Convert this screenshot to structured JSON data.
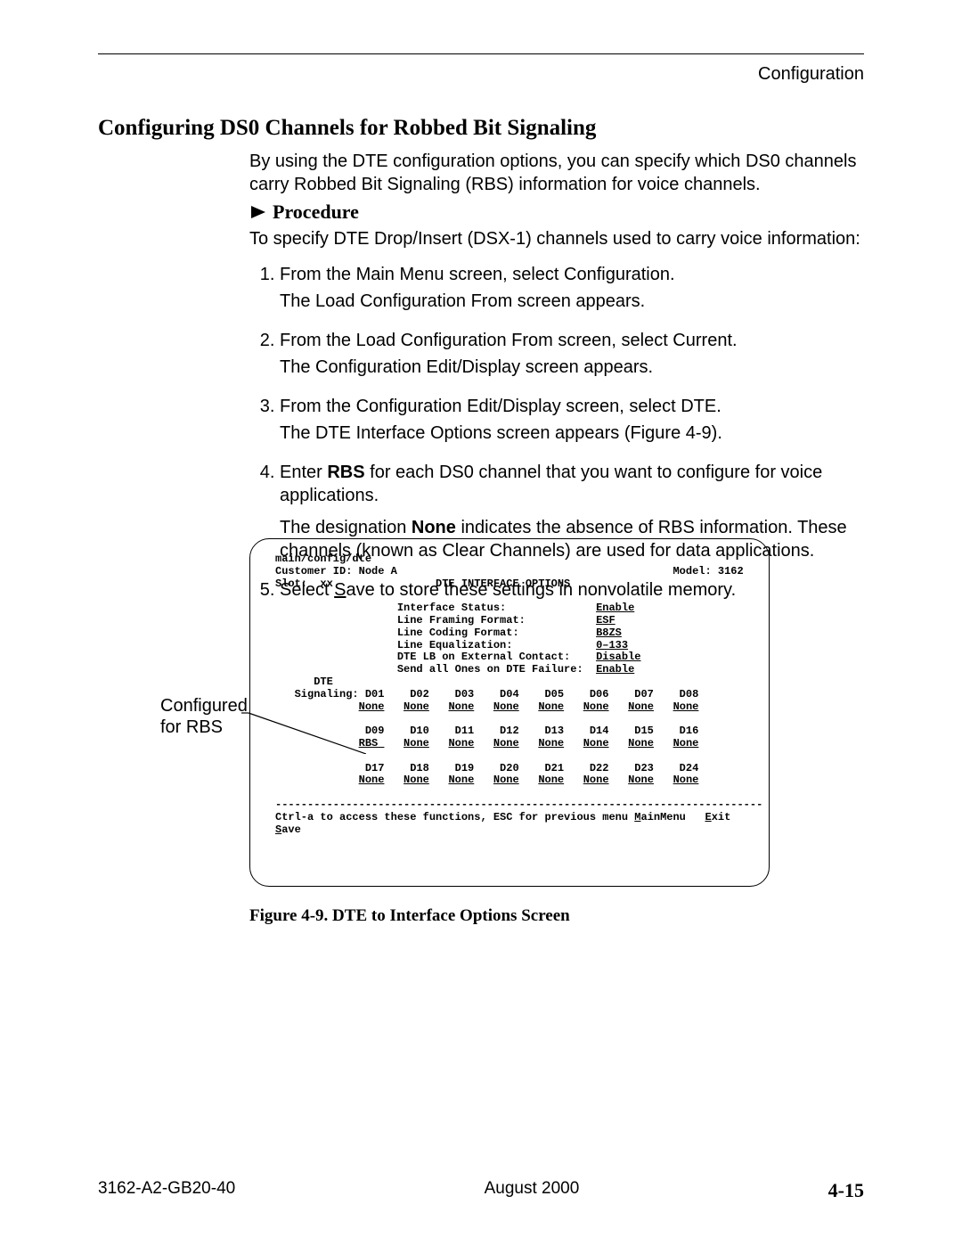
{
  "header": {
    "section": "Configuration"
  },
  "title": "Configuring DS0 Channels for Robbed Bit Signaling",
  "intro": "By using the DTE configuration options, you can specify which DS0 channels carry Robbed Bit Signaling (RBS) information for voice channels.",
  "procedure_label": "Procedure",
  "procedure_intro": "To specify DTE Drop/Insert (DSX-1) channels used to carry voice information:",
  "steps": {
    "s1a": "From the Main Menu screen, select Configuration.",
    "s1b": "The Load Configuration From screen appears.",
    "s2a": "From the Load Configuration From screen, select Current.",
    "s2b": "The Configuration Edit/Display screen appears.",
    "s3a": "From the Configuration Edit/Display screen, select DTE.",
    "s3b": "The DTE Interface Options screen appears (Figure 4-9).",
    "s4a_pre": "Enter ",
    "s4a_bold": "RBS",
    "s4a_post": " for each DS0 channel that you want to configure for voice applications.",
    "s4b_pre": "The designation ",
    "s4b_bold": "None",
    "s4b_post": " indicates the absence of RBS information. These channels (known as Clear Channels) are used for data applications.",
    "s5_pre": "Select ",
    "s5_u": "S",
    "s5_post": "ave to store these settings in nonvolatile memory."
  },
  "callout": {
    "line1": "Configured",
    "line2": "for RBS"
  },
  "terminal": {
    "path": "main/config/dte",
    "customer_label": "Customer ID:",
    "customer_value": "Node A",
    "model_label": "Model:",
    "model_value": "3162",
    "slot_label": "Slot:",
    "slot_value": "xx",
    "screen_title": "DTE INTERFACE OPTIONS",
    "opts": [
      {
        "label": "Interface Status:",
        "value": "Enable"
      },
      {
        "label": "Line Framing Format:",
        "value": "ESF"
      },
      {
        "label": "Line Coding Format:",
        "value": "B8ZS"
      },
      {
        "label": "Line Equalization:",
        "value": "0–133"
      },
      {
        "label": "DTE LB on External Contact:",
        "value": "Disable"
      },
      {
        "label": "Send all Ones on DTE Failure:",
        "value": "Enable"
      }
    ],
    "dte_label": "DTE",
    "signaling_label": "Signaling:",
    "channels": {
      "row1": {
        "labels": [
          "D01",
          "D02",
          "D03",
          "D04",
          "D05",
          "D06",
          "D07",
          "D08"
        ],
        "values": [
          "None",
          "None",
          "None",
          "None",
          "None",
          "None",
          "None",
          "None"
        ]
      },
      "row2": {
        "labels": [
          "D09",
          "D10",
          "D11",
          "D12",
          "D13",
          "D14",
          "D15",
          "D16"
        ],
        "values": [
          "RBS",
          "None",
          "None",
          "None",
          "None",
          "None",
          "None",
          "None"
        ]
      },
      "row3": {
        "labels": [
          "D17",
          "D18",
          "D19",
          "D20",
          "D21",
          "D22",
          "D23",
          "D24"
        ],
        "values": [
          "None",
          "None",
          "None",
          "None",
          "None",
          "None",
          "None",
          "None"
        ]
      }
    },
    "hint": "Ctrl-a to access these functions, ESC for previous menu",
    "menu": {
      "main": "MainMenu",
      "exit": "Exit",
      "save_u": "S",
      "save_rest": "ave"
    }
  },
  "figure_caption": "Figure 4-9.   DTE to Interface Options Screen",
  "footer": {
    "left": "3162-A2-GB20-40",
    "center": "August 2000",
    "right": "4-15"
  }
}
